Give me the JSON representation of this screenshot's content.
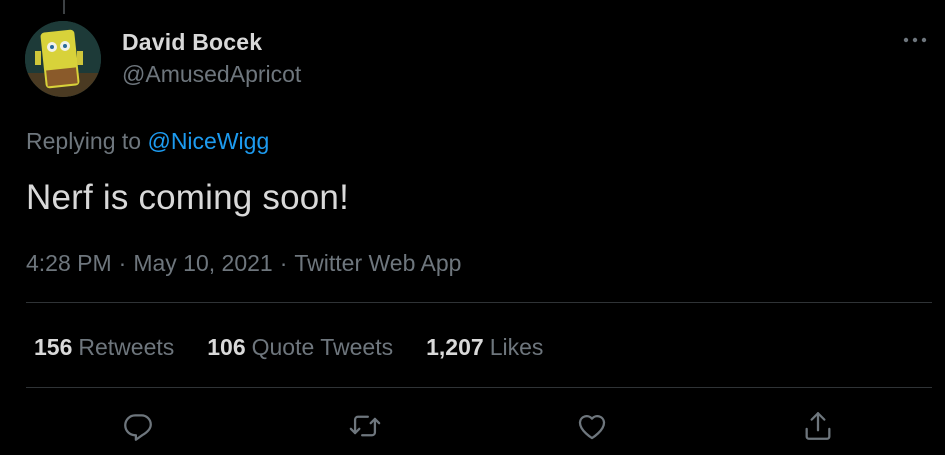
{
  "tweet": {
    "author": {
      "display_name": "David Bocek",
      "handle": "@AmusedApricot",
      "avatar_icon": "spongebob-avatar"
    },
    "replying_prefix": "Replying to",
    "replying_to": "@NiceWigg",
    "text": "Nerf is coming soon!",
    "time": "4:28 PM",
    "date": "May 10, 2021",
    "separator": "·",
    "source": "Twitter Web App"
  },
  "stats": [
    {
      "count": "156",
      "label": "Retweets"
    },
    {
      "count": "106",
      "label": "Quote Tweets"
    },
    {
      "count": "1,207",
      "label": "Likes"
    }
  ],
  "actions": [
    {
      "icon": "reply-icon"
    },
    {
      "icon": "retweet-icon"
    },
    {
      "icon": "like-icon"
    },
    {
      "icon": "share-icon"
    }
  ],
  "colors": {
    "background": "#000000",
    "text_primary": "#d9d9d9",
    "text_secondary": "#6e767d",
    "link": "#1d9bf0",
    "divider": "#2f3336"
  }
}
